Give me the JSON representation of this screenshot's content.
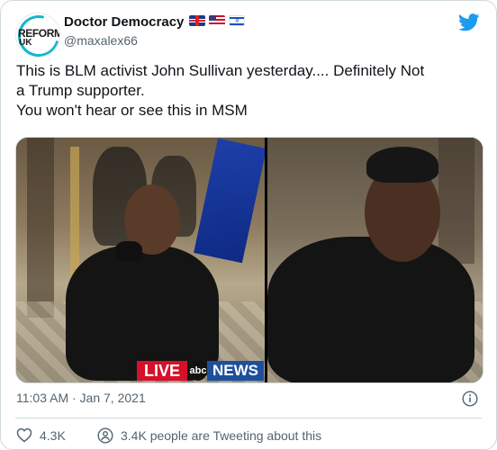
{
  "author": {
    "display_name": "Doctor Democracy",
    "handle": "@maxalex66",
    "avatar_text_line1": "REFORM",
    "avatar_text_line2": "UK",
    "flags": [
      "uk-flag-icon",
      "us-flag-icon",
      "israel-flag-icon"
    ]
  },
  "tweet": {
    "lines": [
      "This is BLM activist John Sullivan yesterday.... Definitely Not",
      "a Trump supporter.",
      "You won't hear or see this in MSM"
    ],
    "timestamp": "11:03 AM · Jan 7, 2021"
  },
  "media": {
    "overlay_live": "LIVE",
    "overlay_abc": "abc",
    "overlay_news": "NEWS"
  },
  "actions": {
    "likes_count": "4.3K",
    "tweeting_text": "3.4K people are Tweeting about this"
  },
  "colors": {
    "twitter_blue": "#1d9bf0",
    "text_primary": "#0f1419",
    "text_secondary": "#536471",
    "border": "#cfd9de"
  }
}
